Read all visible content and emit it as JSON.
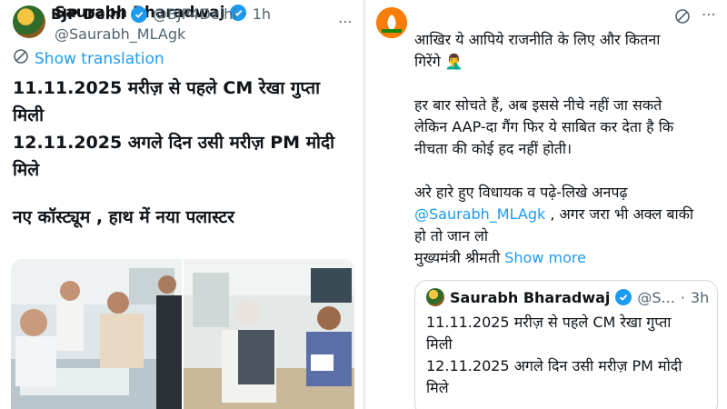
{
  "left_tweet": {
    "author_name": "Saurabh Bharadwaj",
    "handle": "@Saurabh_MLAgk",
    "more_icon": "more-horizontal-icon",
    "show_translation": "Show translation",
    "lines": [
      "11.11.2025 मरीज़ से पहले CM रेखा गुप्ता",
      "मिली",
      "12.11.2025 अगले दिन उसी मरीज़ PM मोदी",
      "मिले",
      "नए कॉस्ट्यूम , हाथ में नया पलास्टर"
    ]
  },
  "right_tweet": {
    "author_name": "BJP Delhi",
    "handle": "@BJP4Delhi",
    "separator": "·",
    "time": "1h",
    "lines": [
      "आखिर ये आपिये राजनीति के लिए और कितना",
      "गिरेंगे 🤦‍♂️",
      "हर बार सोचते हैं, अब इससे नीचे नहीं जा सकते",
      "लेकिन AAP-दा गैंग फिर ये  साबित कर देता है कि",
      "नीचता की कोई हद नहीं होती।",
      "अरे हारे हुए विधायक व पढ़े-लिखे अनपढ़",
      "@Saurabh_MLAgk",
      " , अगर जरा भी अक्ल बाकी",
      "हो तो जान लो",
      "मुख्यमंत्री श्रीमती",
      "Show more"
    ]
  },
  "quoted_tweet": {
    "author_name": "Saurabh Bharadwaj",
    "handle": "@S...",
    "separator": "·",
    "time": "3h",
    "lines": [
      "11.11.2025 मरीज़ से पहले CM रेखा गुप्ता",
      "मिली",
      "12.11.2025 अगले दिन उसी मरीज़ PM मोदी",
      "मिले"
    ]
  },
  "colors": {
    "link": "#1d9bf0",
    "secondary_text": "#536471",
    "verified": "#1d9bf0",
    "bjp_orange": "#f97d09",
    "border": "#cfd9de"
  }
}
